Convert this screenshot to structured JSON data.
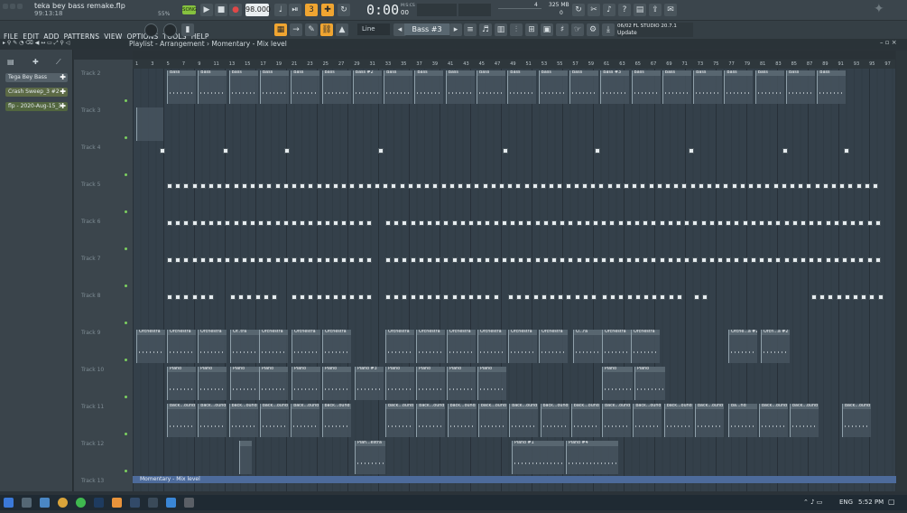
{
  "window": {
    "title": "teka bey bass remake.flp",
    "time_code": "99:13:18",
    "zoom_pct": "55%"
  },
  "transport": {
    "mode": "SONG",
    "tempo": "98.000",
    "time_display": "0:00",
    "time_sub": "00",
    "time_unit": "M:S:CS",
    "cpu_value": "4",
    "memory": "325 MB",
    "memory_sub": "0"
  },
  "menu": [
    "FILE",
    "EDIT",
    "ADD",
    "PATTERNS",
    "VIEW",
    "OPTIONS",
    "TOOLS",
    "HELP"
  ],
  "snap": "Line",
  "pattern_selector": "Bass #3",
  "update_news": {
    "line1": "06/02 FL STUDIO 20.7.1",
    "line2": "Update"
  },
  "breadcrumb": "Playlist - Arrangement › Momentary - Mix level",
  "channels": [
    {
      "label": "Tega Bey Bass"
    },
    {
      "label": "Crash Sweep_3 #2"
    },
    {
      "label": "flp - 2020-Aug-15_3"
    }
  ],
  "ruler_marks": [
    "1",
    "3",
    "5",
    "7",
    "9",
    "11",
    "13",
    "15",
    "17",
    "19",
    "21",
    "23",
    "25",
    "27",
    "29",
    "31",
    "33",
    "35",
    "37",
    "39",
    "41",
    "43",
    "45",
    "47",
    "49",
    "51",
    "53",
    "55",
    "57",
    "59",
    "61",
    "63",
    "65",
    "67",
    "69",
    "71",
    "73",
    "75",
    "77",
    "79",
    "81",
    "83",
    "85",
    "87",
    "89",
    "91",
    "93",
    "95",
    "97"
  ],
  "tracks": [
    {
      "name": "Track 2",
      "clip_label": "Bass",
      "special": "Bass #2",
      "special2": "Bass #3"
    },
    {
      "name": "Track 3"
    },
    {
      "name": "Track 4"
    },
    {
      "name": "Track 5"
    },
    {
      "name": "Track 6"
    },
    {
      "name": "Track 7"
    },
    {
      "name": "Track 8"
    },
    {
      "name": "Track 9",
      "clip_label": "Orchestra",
      "short": "Or..tra",
      "short2": "O...ra",
      "short3": "Orche...a #2",
      "short4": "Orch...a #2"
    },
    {
      "name": "Track 10",
      "clip_label": "Piano",
      "special": "Piano #3"
    },
    {
      "name": "Track 11",
      "clip_label": "back...ound",
      "short": "ba...nd"
    },
    {
      "name": "Track 12",
      "special": "Pian...estra",
      "p1": "Piano #1",
      "p2": "Piano #4"
    },
    {
      "name": "Track 13"
    }
  ],
  "automation_clip": "Momentary - Mix level",
  "taskbar": {
    "lang": "ENG",
    "clock": "5:52 PM"
  },
  "colors": {
    "accent": "#f0a531",
    "led": "#7ccf5f",
    "automation": "#4d6b9b"
  }
}
